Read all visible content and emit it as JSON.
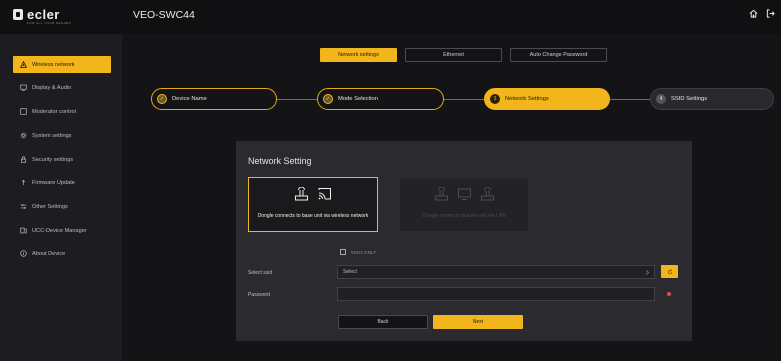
{
  "app": {
    "logo_text": "ecler",
    "logo_subtitle": "FOR ALL YOUR SENSES",
    "device_title": "VEO-SWC44"
  },
  "topbar": {
    "icons": [
      "home-icon",
      "logout-icon"
    ]
  },
  "sidebar": {
    "items": [
      {
        "label": "Wireless network",
        "icon": "wifi-icon",
        "active": true
      },
      {
        "label": "Display & Audio",
        "icon": "display-icon",
        "active": false
      },
      {
        "label": "Moderator control",
        "icon": "window-icon",
        "active": false
      },
      {
        "label": "System settings",
        "icon": "gear-icon",
        "active": false
      },
      {
        "label": "Security settings",
        "icon": "lock-icon",
        "active": false
      },
      {
        "label": "Firmware Update",
        "icon": "upload-icon",
        "active": false
      },
      {
        "label": "Other Settings",
        "icon": "sliders-icon",
        "active": false
      },
      {
        "label": "UCC-Device Manager",
        "icon": "device-manager-icon",
        "active": false
      },
      {
        "label": "About Device",
        "icon": "info-icon",
        "active": false
      }
    ]
  },
  "tabs": [
    {
      "label": "Network settings",
      "active": true
    },
    {
      "label": "Ethernet",
      "active": false
    },
    {
      "label": "Auto Change Password",
      "active": false
    }
  ],
  "steps": [
    {
      "label": "Device Name",
      "state": "done",
      "marker": "✓"
    },
    {
      "label": "Mode Selection",
      "state": "done",
      "marker": "✓"
    },
    {
      "label": "Network Settings",
      "state": "current",
      "marker": "3"
    },
    {
      "label": "SSID Settings",
      "state": "todo",
      "marker": "4"
    }
  ],
  "panel": {
    "title": "Network Setting",
    "modes": [
      {
        "text": "Dongle connects to base unit via wireless network",
        "selected": true
      },
      {
        "text": "Dongle connects to base unit via LAN",
        "selected": false
      }
    ],
    "checkbox_label": "5GHz ONLY",
    "select_ssid_label": "Select ssid",
    "select_ssid_value": "Select",
    "password_label": "Password",
    "password_value": "",
    "back_label": "Back",
    "next_label": "Next"
  },
  "colors": {
    "accent": "#f2b51c",
    "background": "#16161a",
    "sidebar": "#1d1d21",
    "panel": "#2b2b2f",
    "required": "#e04b4b"
  }
}
